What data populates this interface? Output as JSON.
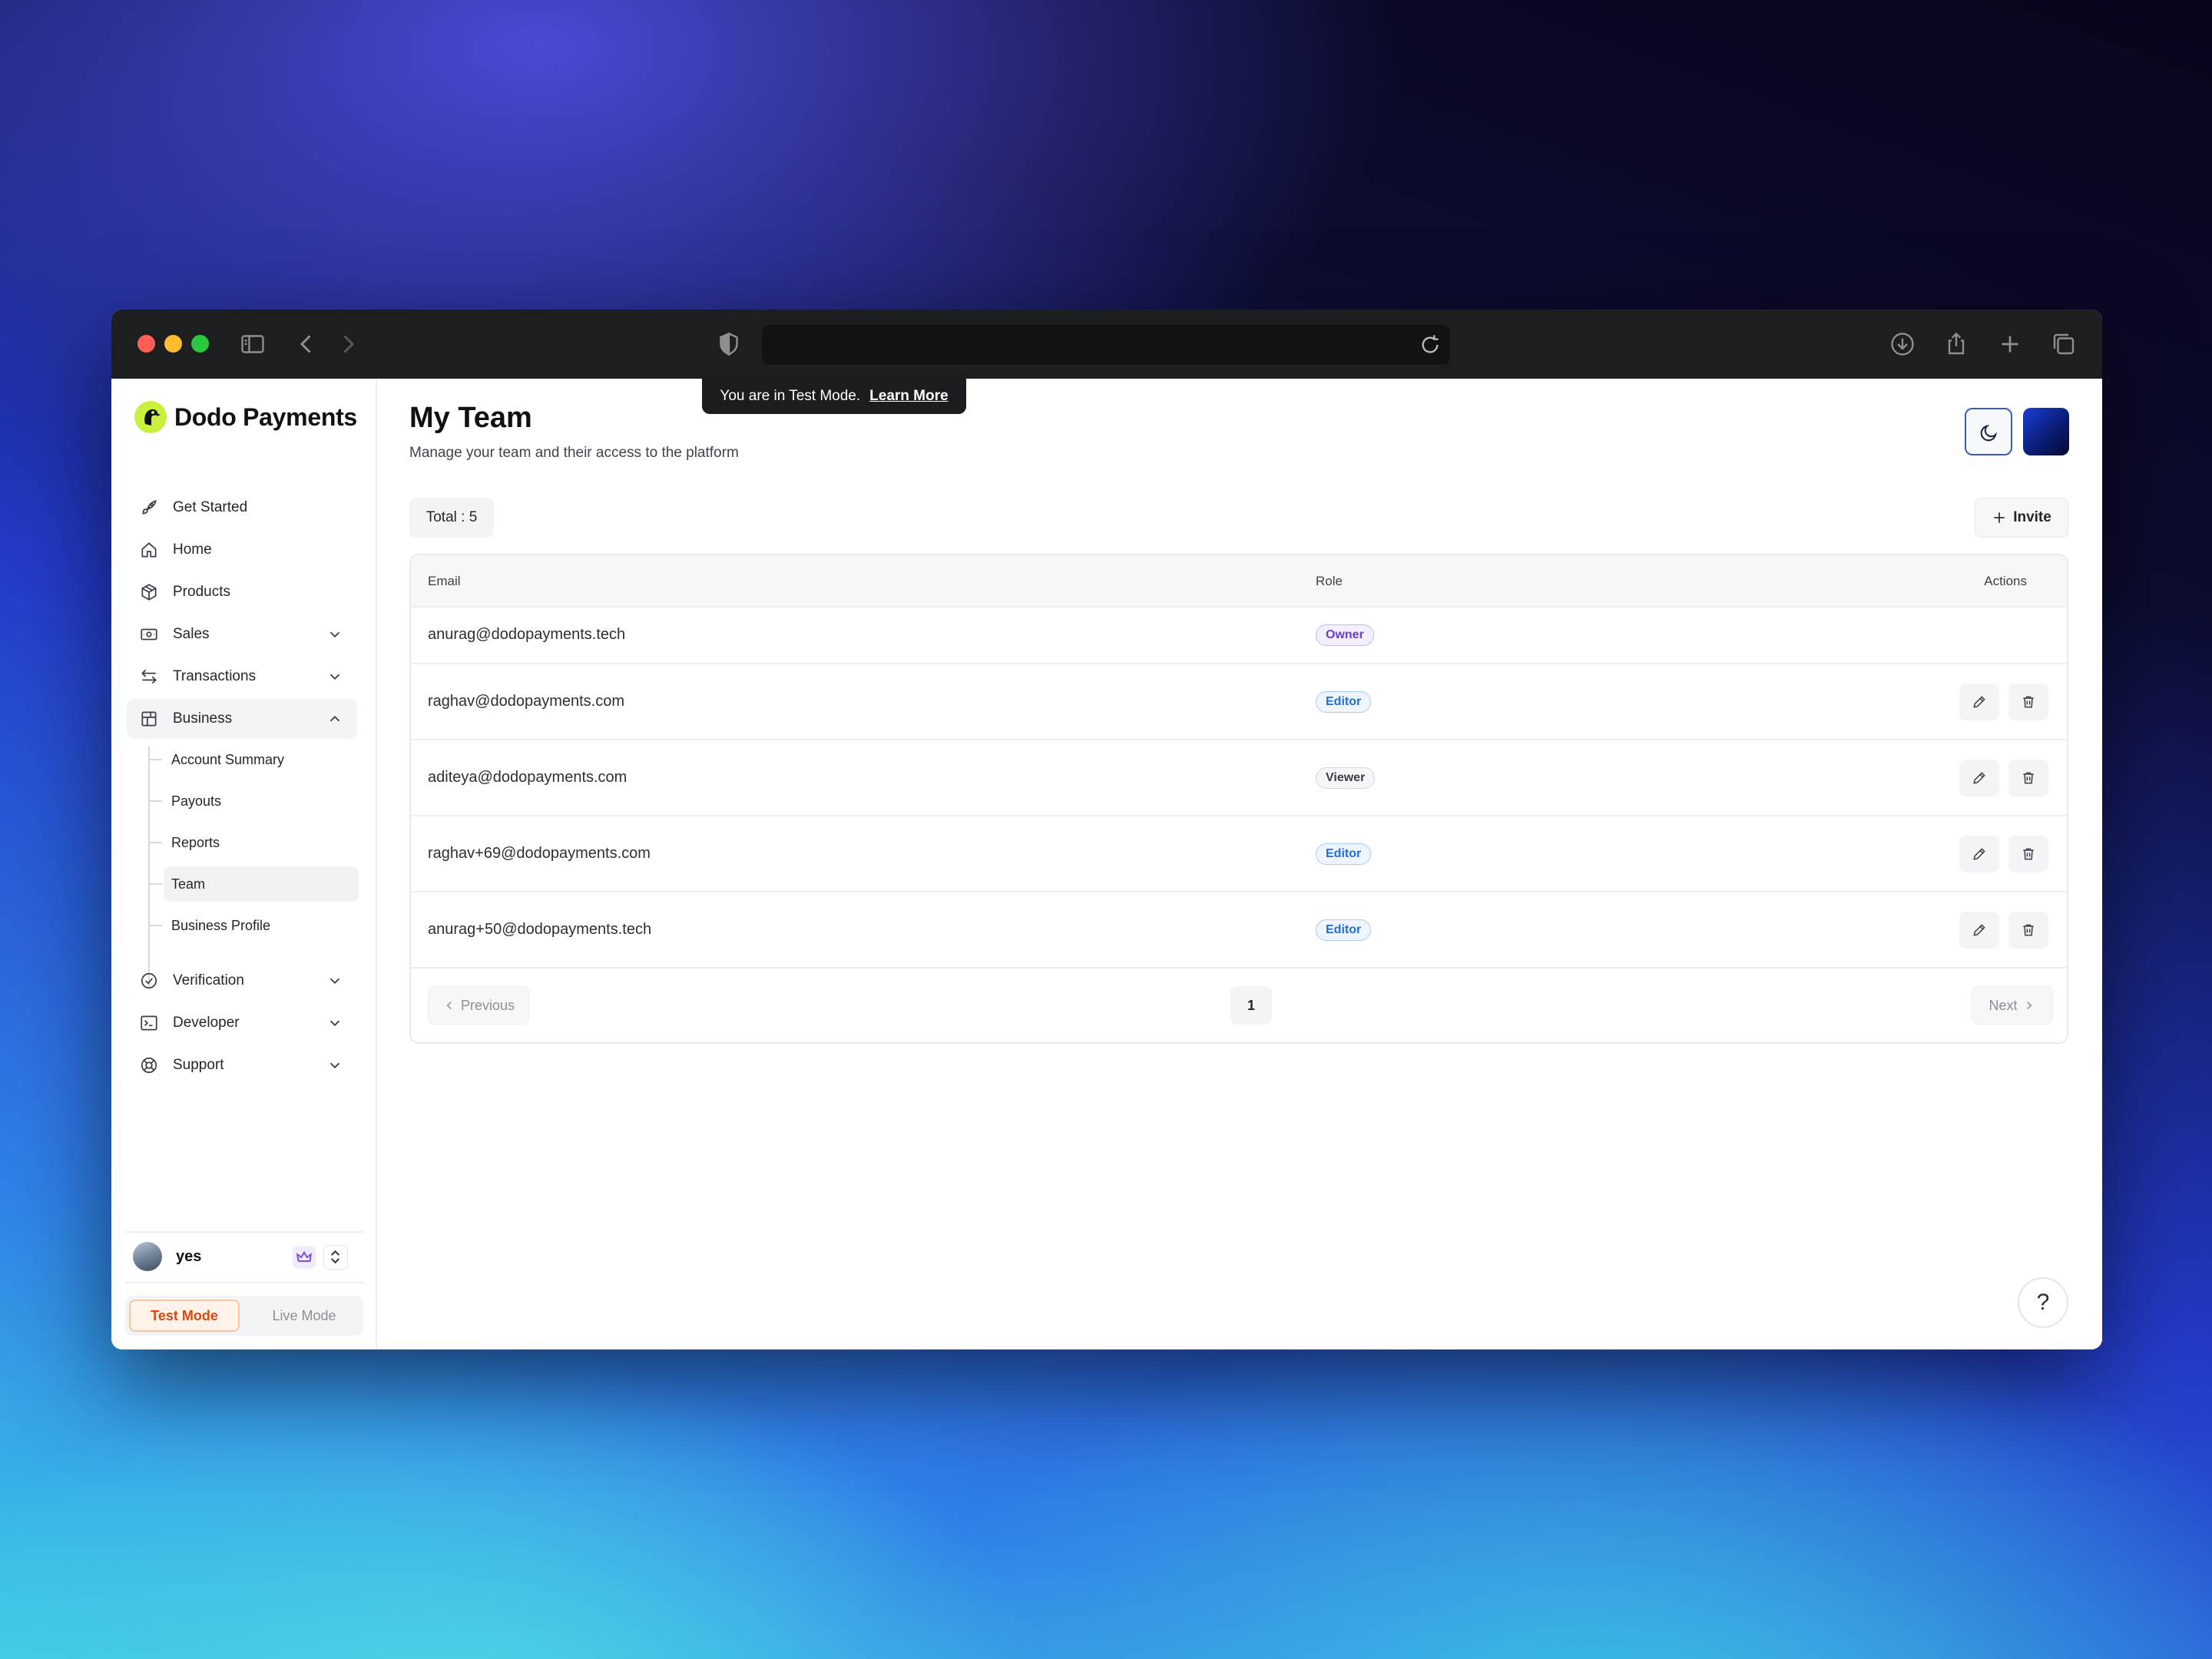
{
  "browser": {
    "url": ""
  },
  "brand": {
    "name": "Dodo Payments"
  },
  "sidebar": {
    "items": [
      {
        "label": "Get Started",
        "icon": "rocket-icon"
      },
      {
        "label": "Home",
        "icon": "home-icon"
      },
      {
        "label": "Products",
        "icon": "package-icon"
      },
      {
        "label": "Sales",
        "icon": "banknote-icon",
        "expandable": true
      },
      {
        "label": "Transactions",
        "icon": "arrows-left-right-icon",
        "expandable": true
      },
      {
        "label": "Business",
        "icon": "store-icon",
        "expandable": true,
        "expanded": true
      },
      {
        "label": "Verification",
        "icon": "badge-check-icon",
        "expandable": true
      },
      {
        "label": "Developer",
        "icon": "terminal-icon",
        "expandable": true
      },
      {
        "label": "Support",
        "icon": "life-buoy-icon",
        "expandable": true
      }
    ],
    "business_sub": [
      {
        "label": "Account Summary"
      },
      {
        "label": "Payouts"
      },
      {
        "label": "Reports"
      },
      {
        "label": "Team",
        "active": true
      },
      {
        "label": "Business Profile"
      }
    ],
    "user": {
      "name": "yes"
    },
    "mode": {
      "test_label": "Test Mode",
      "live_label": "Live Mode",
      "selected": "Test Mode"
    }
  },
  "banner": {
    "text": "You are in Test Mode.",
    "link": "Learn More"
  },
  "header": {
    "title": "My Team",
    "subtitle": "Manage your team and their access to the platform"
  },
  "toolbar": {
    "total_label": "Total : 5",
    "invite_label": "Invite"
  },
  "table": {
    "columns": {
      "email": "Email",
      "role": "Role",
      "actions": "Actions"
    },
    "rows": [
      {
        "email": "anurag@dodopayments.tech",
        "role": "Owner"
      },
      {
        "email": "raghav@dodopayments.com",
        "role": "Editor"
      },
      {
        "email": "aditeya@dodopayments.com",
        "role": "Viewer"
      },
      {
        "email": "raghav+69@dodopayments.com",
        "role": "Editor"
      },
      {
        "email": "anurag+50@dodopayments.tech",
        "role": "Editor"
      }
    ]
  },
  "pagination": {
    "previous_label": "Previous",
    "next_label": "Next",
    "current_page": "1"
  },
  "help": {
    "label": "?"
  },
  "colors": {
    "accent_test_mode": "#d9480f",
    "owner_badge": "#6b3fd0",
    "editor_badge": "#1f6fd6",
    "brand_logo": "#c8f03c"
  }
}
